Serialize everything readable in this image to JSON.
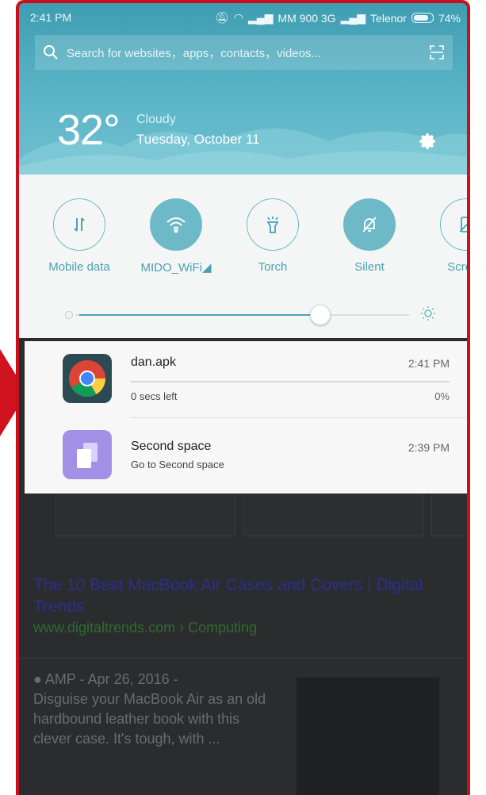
{
  "status_bar": {
    "time": "2:41 PM",
    "carrier1": "MM 900 3G",
    "carrier2": "Telenor",
    "battery": "74%"
  },
  "search": {
    "placeholder": "Search for websites，apps，contacts，videos..."
  },
  "weather": {
    "temperature": "32°",
    "condition": "Cloudy",
    "date": "Tuesday, October 11"
  },
  "toggles": [
    {
      "label": "Mobile data",
      "icon": "mobile-data-icon",
      "active": false
    },
    {
      "label": "MIDO_WiFi◢",
      "icon": "wifi-icon",
      "active": true
    },
    {
      "label": "Torch",
      "icon": "torch-icon",
      "active": false
    },
    {
      "label": "Silent",
      "icon": "silent-bell-icon",
      "active": true
    },
    {
      "label": "Screen",
      "icon": "screenshot-icon",
      "active": false
    }
  ],
  "brightness": {
    "level": 0.73
  },
  "notifications": [
    {
      "title": "dan.apk",
      "time": "2:41 PM",
      "subtitle": "0 secs left",
      "progress": "0%",
      "icon": "chrome-icon"
    },
    {
      "title": "Second space",
      "time": "2:39 PM",
      "subtitle": "Go to Second space",
      "icon": "second-space-icon"
    }
  ],
  "background_page": {
    "result_title": "The 10 Best MacBook Air Cases and Covers | Digital Trends",
    "result_url": "www.digitaltrends.com › Computing",
    "snippet_meta": "AMP - Apr 26, 2016 -",
    "snippet": "Disguise your MacBook Air as an old hardbound leather book with this clever case. It's tough, with ..."
  },
  "colors": {
    "accent": "#6db9c7",
    "header_top": "#3f9db2",
    "annotation_red": "#c8101e"
  }
}
